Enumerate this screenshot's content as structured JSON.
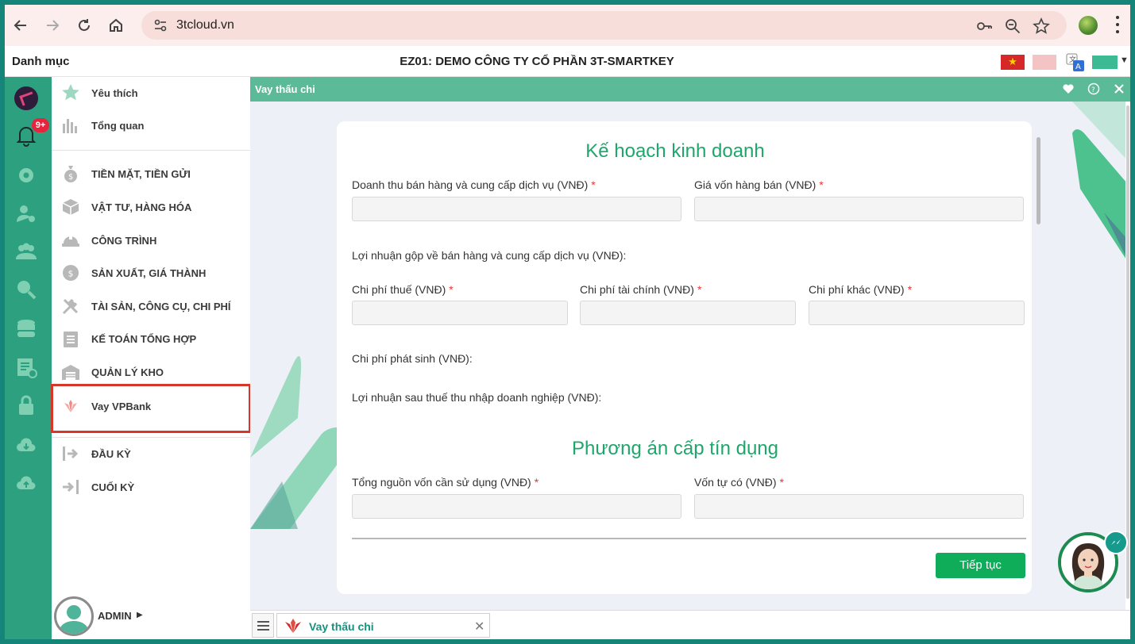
{
  "browser": {
    "url": "3tcloud.vn"
  },
  "app_header": {
    "menu_title": "Danh mục",
    "company": "EZ01: DEMO CÔNG TY CỔ PHẦN 3T-SMARTKEY"
  },
  "icon_rail": {
    "notification_badge": "9+",
    "items": [
      "settings-icon",
      "user-settings-icon",
      "users-icon",
      "search-icon",
      "database-icon",
      "report-icon",
      "lock-icon",
      "cloud-download-icon",
      "cloud-upload-icon"
    ]
  },
  "sidebar": {
    "items": [
      {
        "label": "Yêu thích",
        "icon": "star-icon"
      },
      {
        "label": "Tổng quan",
        "icon": "bar-chart-icon"
      },
      {
        "label": "TIỀN MẶT, TIỀN GỬI",
        "icon": "money-bag-icon"
      },
      {
        "label": "VẬT TƯ, HÀNG HÓA",
        "icon": "box-icon"
      },
      {
        "label": "CÔNG TRÌNH",
        "icon": "helmet-icon"
      },
      {
        "label": "SẢN XUẤT, GIÁ THÀNH",
        "icon": "gear-dollar-icon"
      },
      {
        "label": "TÀI SẢN, CÔNG CỤ, CHI PHÍ",
        "icon": "tools-icon"
      },
      {
        "label": "KẾ TOÁN TỔNG HỢP",
        "icon": "clipboard-icon"
      },
      {
        "label": "QUẢN LÝ KHO",
        "icon": "warehouse-icon"
      },
      {
        "label": "Vay VPBank",
        "icon": "vpbank-logo-icon"
      },
      {
        "label": "ĐẦU KỲ",
        "icon": "period-start-icon"
      },
      {
        "label": "CUỐI KỲ",
        "icon": "period-end-icon"
      }
    ],
    "user_label": "ADMIN"
  },
  "window": {
    "title": "Vay thấu chi"
  },
  "form": {
    "section1_title": "Kế hoạch kinh doanh",
    "revenue_label": "Doanh thu bán hàng và cung cấp dịch vụ (VNĐ)",
    "cogs_label": "Giá vốn hàng bán (VNĐ)",
    "gross_profit_label": "Lợi nhuận gộp về bán hàng và cung cấp dịch vụ (VNĐ):",
    "tax_cost_label": "Chi phí thuế (VNĐ)",
    "finance_cost_label": "Chi phí tài chính (VNĐ)",
    "other_cost_label": "Chi phí khác (VNĐ)",
    "incurred_cost_label": "Chi phí phát sinh (VNĐ):",
    "net_profit_label": "Lợi nhuận sau thuế thu nhập doanh nghiệp (VNĐ):",
    "section2_title": "Phương án cấp tín dụng",
    "total_capital_label": "Tổng nguồn vốn cần sử dụng (VNĐ)",
    "own_capital_label": "Vốn tự có (VNĐ)",
    "required_mark": "*",
    "continue_label": "Tiếp tục"
  },
  "taskbar": {
    "tab_label": "Vay thấu chi",
    "close_glyph": "✕"
  },
  "colors": {
    "rail": "#2da07f",
    "titlebar": "#5bbb98",
    "accent_green": "#1fa66a",
    "button_green": "#0fac5a",
    "highlight_red": "#d6372b"
  }
}
